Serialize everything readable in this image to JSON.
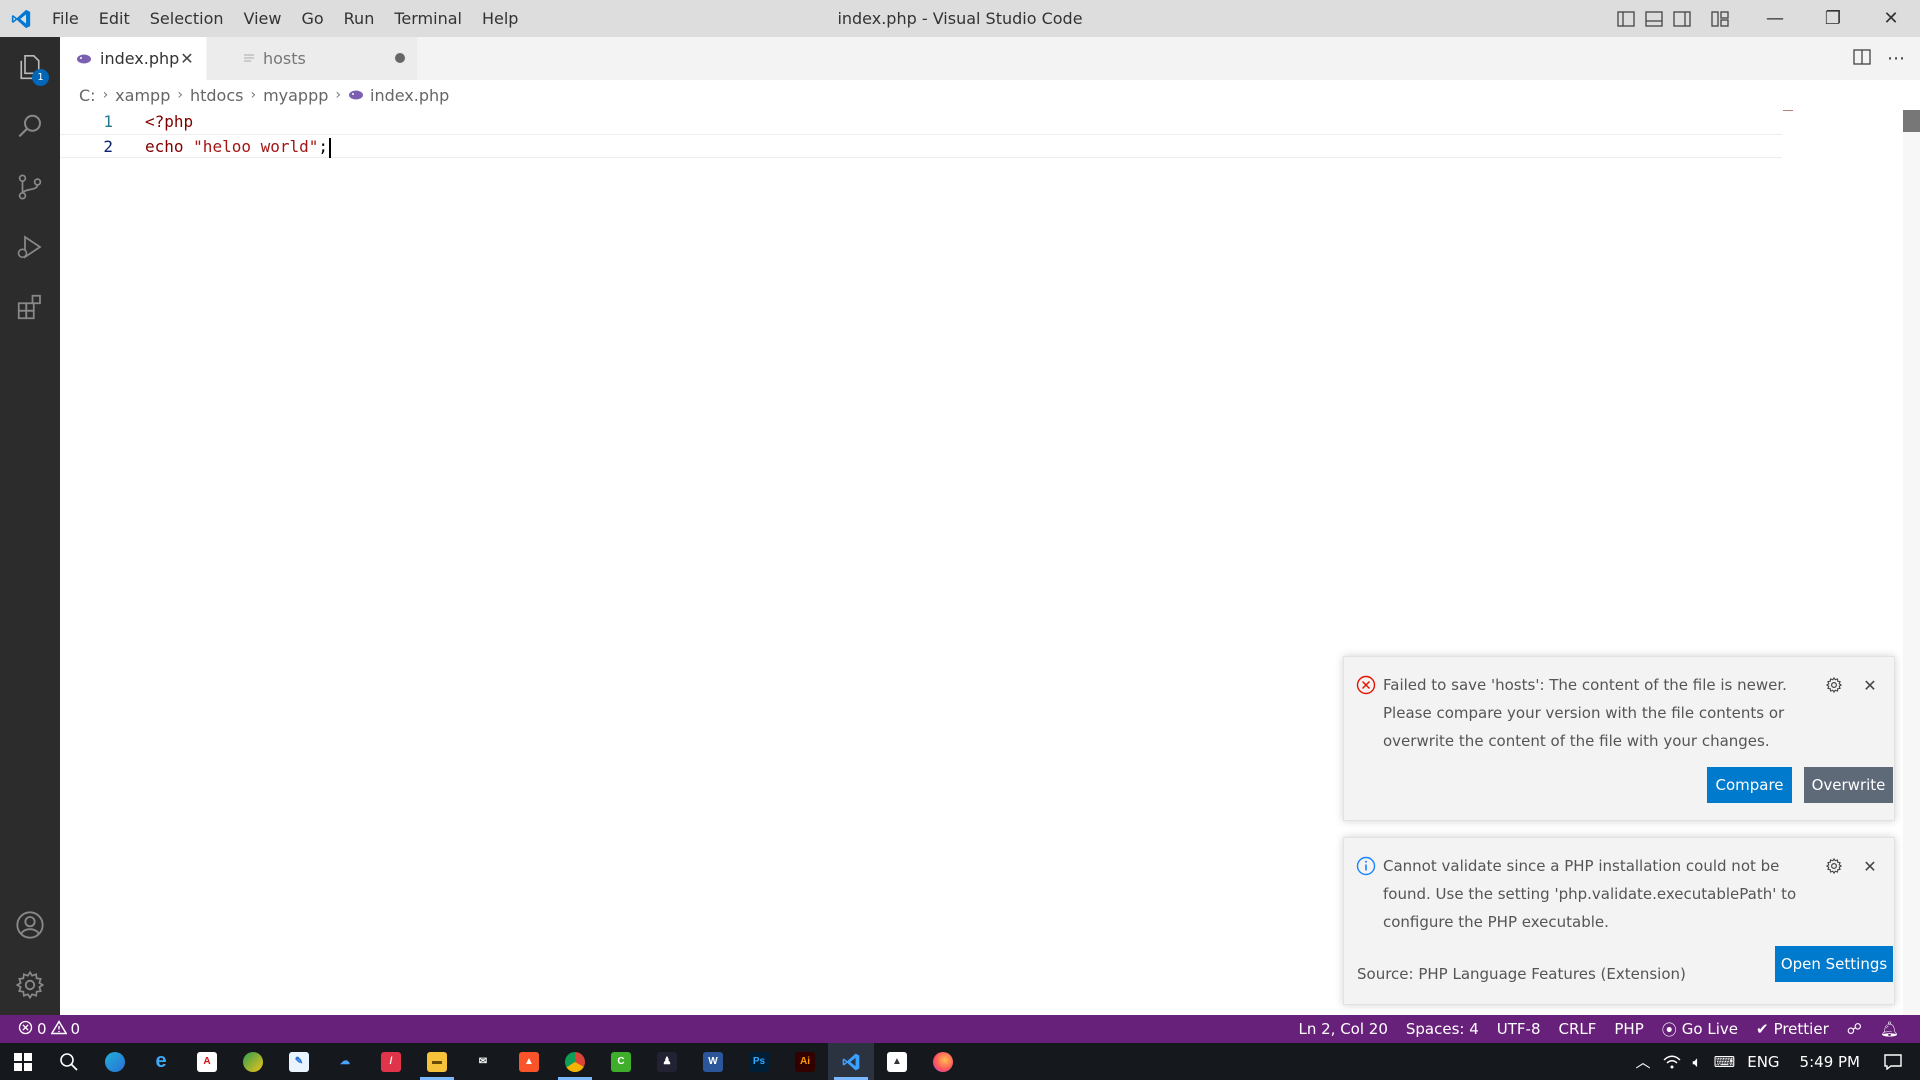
{
  "window": {
    "title": "index.php - Visual Studio Code",
    "menu": [
      "File",
      "Edit",
      "Selection",
      "View",
      "Go",
      "Run",
      "Terminal",
      "Help"
    ],
    "controls": {
      "minimize": "—",
      "restore": "❐",
      "close": "✕"
    }
  },
  "activity_bar": {
    "items": [
      "explorer-icon",
      "search-icon",
      "source-control-icon",
      "run-debug-icon",
      "extensions-icon"
    ],
    "explorer_badge": "1",
    "bottom": [
      "account-icon",
      "manage-gear-icon"
    ]
  },
  "tabs": [
    {
      "label": "index.php",
      "active": true,
      "icon": "php-elephant-icon"
    },
    {
      "label": "hosts",
      "active": false,
      "dirty": true,
      "icon": "text-file-icon"
    }
  ],
  "breadcrumb": [
    "C:",
    "xampp",
    "htdocs",
    "myappp",
    "index.php"
  ],
  "editor": {
    "lines": [
      {
        "number": "1",
        "text": "<?php"
      },
      {
        "number": "2",
        "text": "echo \"heloo world\";"
      }
    ],
    "line2_keyword": "echo",
    "line2_string": "\"heloo world\"",
    "line2_semicolon": ";"
  },
  "notifications": [
    {
      "type": "error",
      "message": "Failed to save 'hosts': The content of the file is newer. Please compare your version with the file contents or overwrite the content of the file with your changes.",
      "buttons": [
        "Compare",
        "Overwrite"
      ]
    },
    {
      "type": "info",
      "message": "Cannot validate since a PHP installation could not be found. Use the setting 'php.validate.executablePath' to configure the PHP executable.",
      "source": "Source: PHP Language Features (Extension)",
      "buttons": [
        "Open Settings"
      ]
    }
  ],
  "status_bar": {
    "errors": "0",
    "warnings": "0",
    "position": "Ln 2, Col 20",
    "spaces": "Spaces: 4",
    "encoding": "UTF-8",
    "eol": "CRLF",
    "language": "PHP",
    "go_live": "Go Live",
    "prettier": "Prettier"
  },
  "taskbar": {
    "language": "ENG",
    "time": "5:49 PM",
    "apps": [
      "Ps",
      "Ai"
    ]
  },
  "colors": {
    "status_bar": "#68217a",
    "accent_blue": "#007acc",
    "activity_bar": "#2c2c2c",
    "error": "#e51400"
  }
}
